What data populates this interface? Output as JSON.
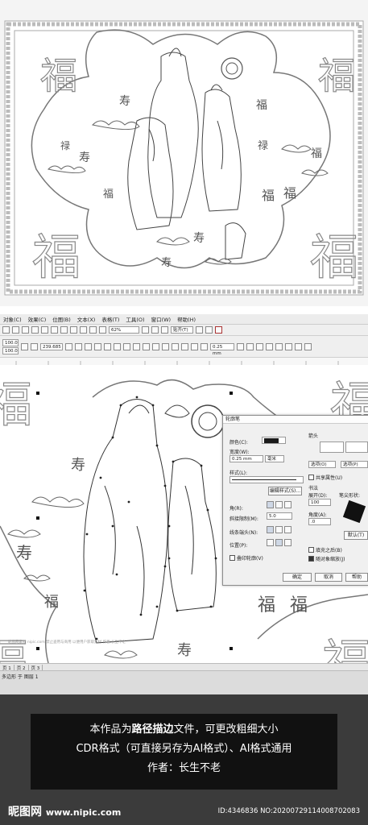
{
  "menubar": {
    "items": [
      "对象(C)",
      "效果(C)",
      "位图(B)",
      "文本(X)",
      "表格(T)",
      "工具(O)",
      "窗口(W)",
      "帮助(H)"
    ]
  },
  "toolbar1": {
    "zoom": "62%",
    "snap": "贴齐(T)"
  },
  "toolbar2": {
    "x": "100.0",
    "y": "100.0",
    "angle": "239.685",
    "outline": "0.25 mm"
  },
  "canvas": {
    "watermark": "昵图网素材 nipic.com 禁止盗用与商用 以便用户获取素材 作者:长生不老"
  },
  "dialog": {
    "title": "轮廓笔",
    "color_label": "颜色(C):",
    "width_label": "宽度(W):",
    "width_value": "0.25 mm",
    "unit_value": "毫米",
    "style_label": "样式(L):",
    "edit_style_button": "编辑样式(S)...",
    "corner_label": "角(R):",
    "miter_label": "斜接限制(M):",
    "miter_value": "5.0",
    "cap_label": "线条端头(N):",
    "position_label": "位置(P):",
    "overprint_label": "叠印轮廓(V)",
    "arrows_label": "箭头",
    "options_left": "选项(O)",
    "options_right": "选项(P)",
    "share_attr_label": "共享属性(U)",
    "calligraphy_label": "书法",
    "spread_label": "展开(D):",
    "spread_value": "100",
    "angle_label": "角度(A):",
    "angle_value": ".0",
    "nib_label": "笔尖形状:",
    "default_button": "默认(T)",
    "fill_behind_label": "填充之后(B)",
    "scale_label": "随对象缩放(J)",
    "ok_button": "确定",
    "cancel_button": "取消",
    "help_button": "帮助"
  },
  "page_tabs": [
    "页 1",
    "页 2",
    "页 3"
  ],
  "status": {
    "layer": "多边形 于 图层 1"
  },
  "info": {
    "line1_prefix": "本作品为",
    "line1_bold": "路径描边",
    "line1_suffix": "文件，可更改粗细大小",
    "line2": "CDR格式（可直接另存为AI格式）、AI格式通用",
    "line3": "作者：长生不老"
  },
  "footer": {
    "logo": "昵图网",
    "url": "www.nipic.com",
    "id": "ID:4346836 NO:20200729114008702083"
  },
  "art": {
    "fu_char": "福",
    "shou_char": "寿",
    "lu_char": "禄"
  },
  "colors": {
    "dialog_color_swatch": "#1a1a1a",
    "nib_shape": "#111111",
    "bottom_bg": "#3b3b3b"
  }
}
